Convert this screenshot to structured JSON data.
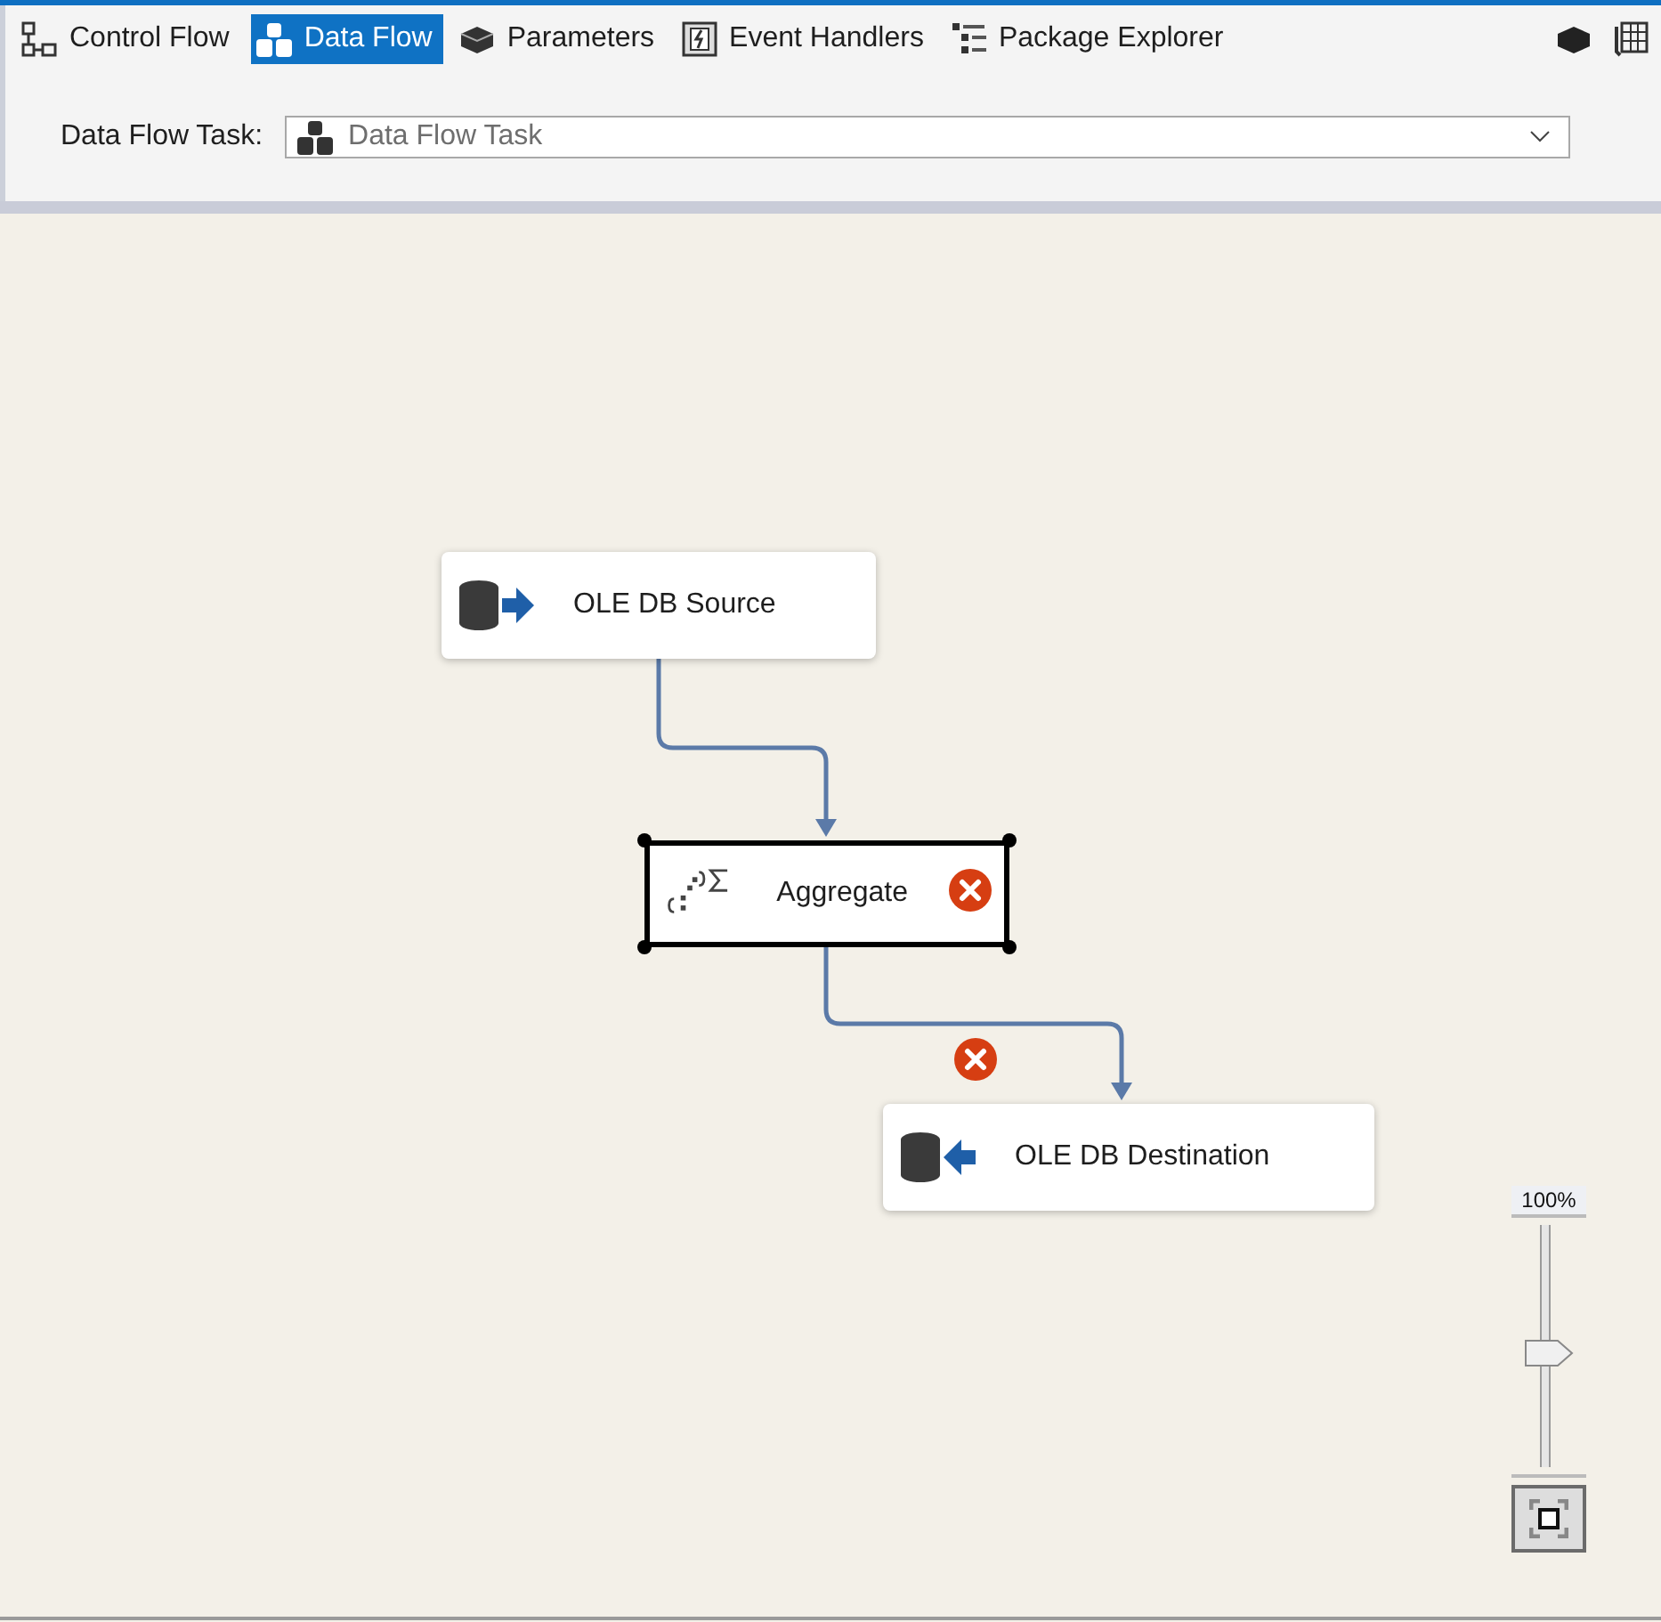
{
  "tabs": [
    {
      "label": "Control Flow",
      "kind": "control",
      "selected": false
    },
    {
      "label": "Data Flow",
      "kind": "data",
      "selected": true
    },
    {
      "label": "Parameters",
      "kind": "params",
      "selected": false
    },
    {
      "label": "Event Handlers",
      "kind": "event",
      "selected": false
    },
    {
      "label": "Package Explorer",
      "kind": "explorer",
      "selected": false
    }
  ],
  "task_selector": {
    "label": "Data Flow Task:",
    "value": "Data Flow Task"
  },
  "nodes": [
    {
      "label": "OLE DB Source",
      "kind": "source",
      "selected": false,
      "error": false
    },
    {
      "label": "Aggregate",
      "kind": "aggregate",
      "selected": true,
      "error": true
    },
    {
      "label": "OLE DB Destination",
      "kind": "destination",
      "selected": false,
      "error": false
    }
  ],
  "paths": [
    {
      "error": false
    },
    {
      "error": true
    }
  ],
  "zoom": {
    "reading": "100%",
    "level": 0.47
  }
}
